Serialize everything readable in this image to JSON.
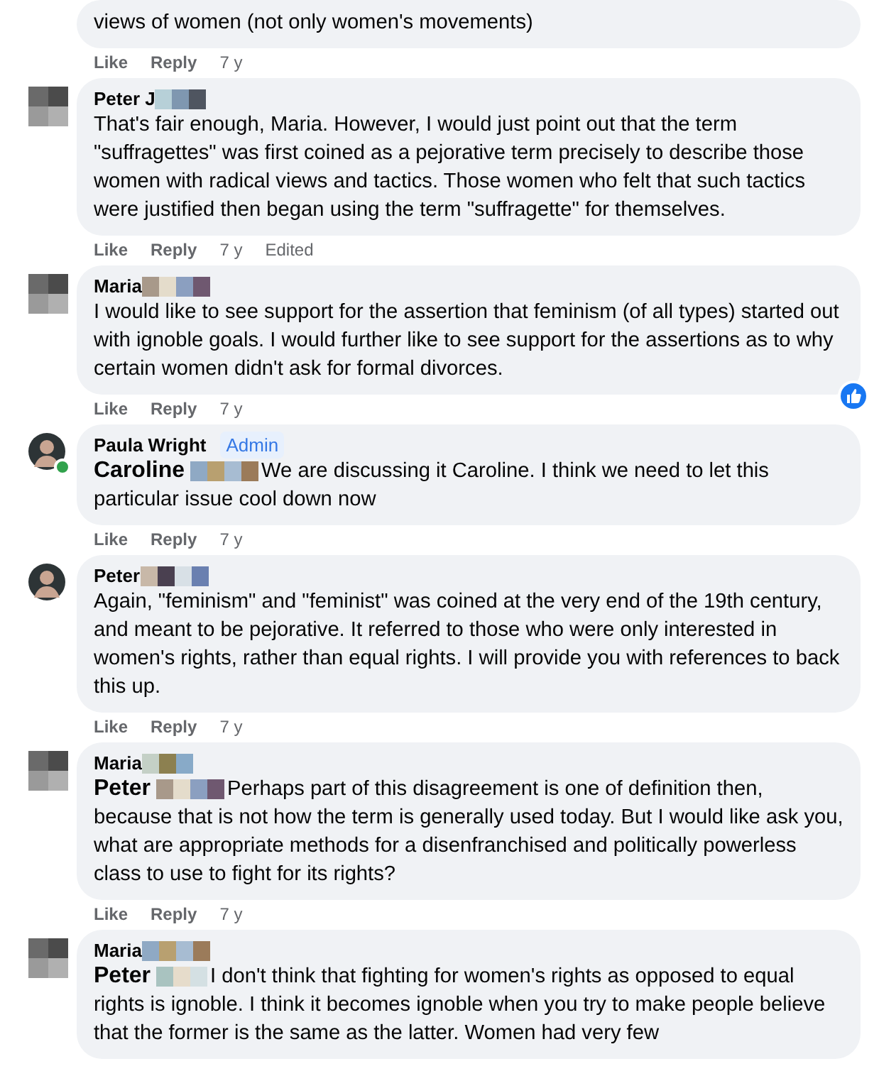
{
  "comments": [
    {
      "text": "views of women (not only women's movements)",
      "actions": [
        "Like",
        "Reply"
      ],
      "time": "7 y"
    },
    {
      "author": "Peter J",
      "name_obscured": true,
      "avatar": {
        "kind": "pixelated"
      },
      "text": "That's fair enough, Maria. However, I would just point out that the term \"suffragettes\" was first coined as a pejorative term precisely to describe those women with radical views and tactics. Those women who felt that such tactics were justified then began using the term \"suffragette\" for themselves.",
      "actions": [
        "Like",
        "Reply"
      ],
      "time": "7 y",
      "edited": "Edited"
    },
    {
      "author": "Maria",
      "name_obscured": true,
      "avatar": {
        "kind": "pixelated"
      },
      "text": "I would like to see support for the assertion that feminism (of all types) started out with ignoble goals. I would further like to see support for the assertions as to why certain women didn't ask for formal divorces.",
      "actions": [
        "Like",
        "Reply"
      ],
      "time": "7 y",
      "reaction": true
    },
    {
      "author": "Paula Wright",
      "badge": "Admin",
      "avatar": {
        "kind": "photo"
      },
      "online": true,
      "mention": "Caroline",
      "text": "We are discussing it Caroline. I think we need to let this particular issue cool down now",
      "actions": [
        "Like",
        "Reply"
      ],
      "time": "7 y"
    },
    {
      "author": "Peter",
      "name_obscured": true,
      "avatar": {
        "kind": "photo"
      },
      "text": "Again, \"feminism\" and \"feminist\" was coined at the very end of the 19th century, and meant to be pejorative. It referred to those who were only interested in women's rights, rather than equal rights. I will provide you with references to back this up.",
      "actions": [
        "Like",
        "Reply"
      ],
      "time": "7 y"
    },
    {
      "author": "Maria",
      "name_obscured": true,
      "avatar": {
        "kind": "pixelated"
      },
      "mention": "Peter",
      "text": "Perhaps part of this disagreement is one of definition then, because that is not how the term is generally used today. But I would like ask you, what are appropriate methods for a disenfranchised and politically powerless class to use to fight for its rights?",
      "actions": [
        "Like",
        "Reply"
      ],
      "time": "7 y"
    },
    {
      "author": "Maria",
      "name_obscured": true,
      "avatar": {
        "kind": "pixelated"
      },
      "mention": "Peter",
      "text": "I don't think that fighting for women's rights as opposed to equal rights is ignoble. I think it becomes ignoble when you try to make people believe that the former is the same as the latter. Women had very few"
    }
  ]
}
